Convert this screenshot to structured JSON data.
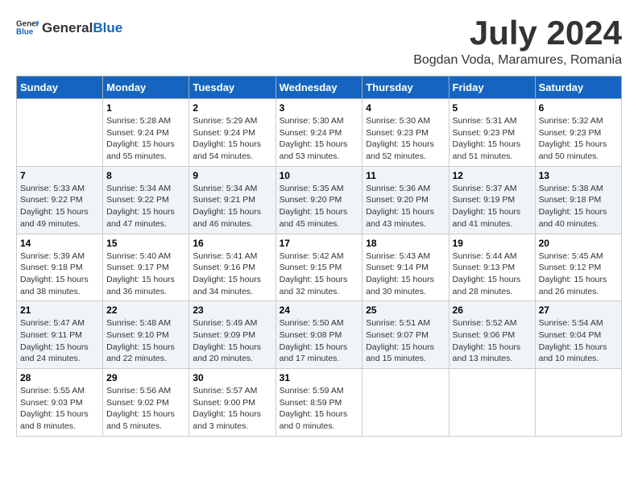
{
  "logo": {
    "text_general": "General",
    "text_blue": "Blue"
  },
  "title": "July 2024",
  "subtitle": "Bogdan Voda, Maramures, Romania",
  "days_of_week": [
    "Sunday",
    "Monday",
    "Tuesday",
    "Wednesday",
    "Thursday",
    "Friday",
    "Saturday"
  ],
  "weeks": [
    [
      {
        "day": "",
        "content": ""
      },
      {
        "day": "1",
        "content": "Sunrise: 5:28 AM\nSunset: 9:24 PM\nDaylight: 15 hours\nand 55 minutes."
      },
      {
        "day": "2",
        "content": "Sunrise: 5:29 AM\nSunset: 9:24 PM\nDaylight: 15 hours\nand 54 minutes."
      },
      {
        "day": "3",
        "content": "Sunrise: 5:30 AM\nSunset: 9:24 PM\nDaylight: 15 hours\nand 53 minutes."
      },
      {
        "day": "4",
        "content": "Sunrise: 5:30 AM\nSunset: 9:23 PM\nDaylight: 15 hours\nand 52 minutes."
      },
      {
        "day": "5",
        "content": "Sunrise: 5:31 AM\nSunset: 9:23 PM\nDaylight: 15 hours\nand 51 minutes."
      },
      {
        "day": "6",
        "content": "Sunrise: 5:32 AM\nSunset: 9:23 PM\nDaylight: 15 hours\nand 50 minutes."
      }
    ],
    [
      {
        "day": "7",
        "content": "Sunrise: 5:33 AM\nSunset: 9:22 PM\nDaylight: 15 hours\nand 49 minutes."
      },
      {
        "day": "8",
        "content": "Sunrise: 5:34 AM\nSunset: 9:22 PM\nDaylight: 15 hours\nand 47 minutes."
      },
      {
        "day": "9",
        "content": "Sunrise: 5:34 AM\nSunset: 9:21 PM\nDaylight: 15 hours\nand 46 minutes."
      },
      {
        "day": "10",
        "content": "Sunrise: 5:35 AM\nSunset: 9:20 PM\nDaylight: 15 hours\nand 45 minutes."
      },
      {
        "day": "11",
        "content": "Sunrise: 5:36 AM\nSunset: 9:20 PM\nDaylight: 15 hours\nand 43 minutes."
      },
      {
        "day": "12",
        "content": "Sunrise: 5:37 AM\nSunset: 9:19 PM\nDaylight: 15 hours\nand 41 minutes."
      },
      {
        "day": "13",
        "content": "Sunrise: 5:38 AM\nSunset: 9:18 PM\nDaylight: 15 hours\nand 40 minutes."
      }
    ],
    [
      {
        "day": "14",
        "content": "Sunrise: 5:39 AM\nSunset: 9:18 PM\nDaylight: 15 hours\nand 38 minutes."
      },
      {
        "day": "15",
        "content": "Sunrise: 5:40 AM\nSunset: 9:17 PM\nDaylight: 15 hours\nand 36 minutes."
      },
      {
        "day": "16",
        "content": "Sunrise: 5:41 AM\nSunset: 9:16 PM\nDaylight: 15 hours\nand 34 minutes."
      },
      {
        "day": "17",
        "content": "Sunrise: 5:42 AM\nSunset: 9:15 PM\nDaylight: 15 hours\nand 32 minutes."
      },
      {
        "day": "18",
        "content": "Sunrise: 5:43 AM\nSunset: 9:14 PM\nDaylight: 15 hours\nand 30 minutes."
      },
      {
        "day": "19",
        "content": "Sunrise: 5:44 AM\nSunset: 9:13 PM\nDaylight: 15 hours\nand 28 minutes."
      },
      {
        "day": "20",
        "content": "Sunrise: 5:45 AM\nSunset: 9:12 PM\nDaylight: 15 hours\nand 26 minutes."
      }
    ],
    [
      {
        "day": "21",
        "content": "Sunrise: 5:47 AM\nSunset: 9:11 PM\nDaylight: 15 hours\nand 24 minutes."
      },
      {
        "day": "22",
        "content": "Sunrise: 5:48 AM\nSunset: 9:10 PM\nDaylight: 15 hours\nand 22 minutes."
      },
      {
        "day": "23",
        "content": "Sunrise: 5:49 AM\nSunset: 9:09 PM\nDaylight: 15 hours\nand 20 minutes."
      },
      {
        "day": "24",
        "content": "Sunrise: 5:50 AM\nSunset: 9:08 PM\nDaylight: 15 hours\nand 17 minutes."
      },
      {
        "day": "25",
        "content": "Sunrise: 5:51 AM\nSunset: 9:07 PM\nDaylight: 15 hours\nand 15 minutes."
      },
      {
        "day": "26",
        "content": "Sunrise: 5:52 AM\nSunset: 9:06 PM\nDaylight: 15 hours\nand 13 minutes."
      },
      {
        "day": "27",
        "content": "Sunrise: 5:54 AM\nSunset: 9:04 PM\nDaylight: 15 hours\nand 10 minutes."
      }
    ],
    [
      {
        "day": "28",
        "content": "Sunrise: 5:55 AM\nSunset: 9:03 PM\nDaylight: 15 hours\nand 8 minutes."
      },
      {
        "day": "29",
        "content": "Sunrise: 5:56 AM\nSunset: 9:02 PM\nDaylight: 15 hours\nand 5 minutes."
      },
      {
        "day": "30",
        "content": "Sunrise: 5:57 AM\nSunset: 9:00 PM\nDaylight: 15 hours\nand 3 minutes."
      },
      {
        "day": "31",
        "content": "Sunrise: 5:59 AM\nSunset: 8:59 PM\nDaylight: 15 hours\nand 0 minutes."
      },
      {
        "day": "",
        "content": ""
      },
      {
        "day": "",
        "content": ""
      },
      {
        "day": "",
        "content": ""
      }
    ]
  ]
}
